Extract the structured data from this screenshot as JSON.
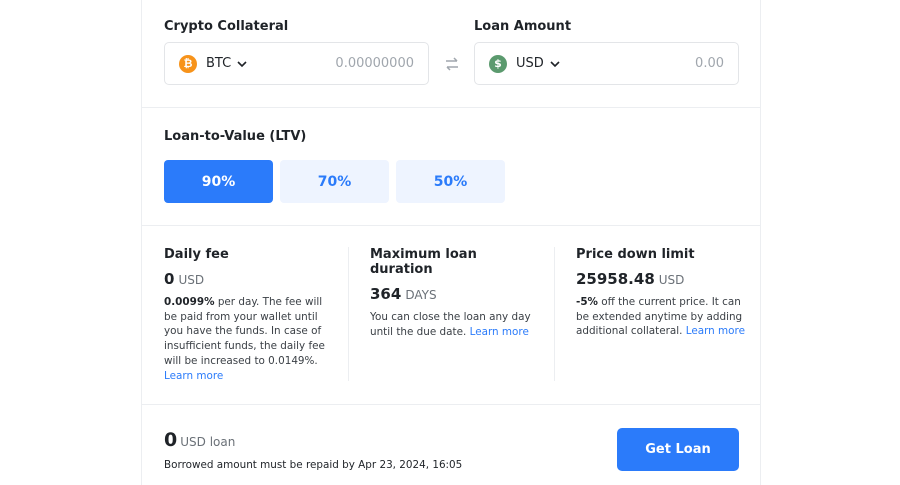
{
  "collateral": {
    "label": "Crypto Collateral",
    "currency": "BTC",
    "coin_glyph": "₿",
    "amount_placeholder": "0.00000000"
  },
  "loan": {
    "label": "Loan Amount",
    "currency": "USD",
    "coin_glyph": "$",
    "amount_placeholder": "0.00"
  },
  "ltv": {
    "title": "Loan-to-Value (LTV)",
    "options": [
      {
        "label": "90%",
        "selected": true
      },
      {
        "label": "70%",
        "selected": false
      },
      {
        "label": "50%",
        "selected": false
      }
    ]
  },
  "info": {
    "daily_fee": {
      "title": "Daily fee",
      "value": "0",
      "unit": "USD",
      "rate": "0.0099%",
      "desc": " per day. The fee will be paid from your wallet until you have the funds. In case of insufficient funds, the daily fee will be increased to 0.0149%.",
      "link": "Learn more"
    },
    "max_duration": {
      "title": "Maximum loan duration",
      "value": "364",
      "unit": "DAYS",
      "desc": "You can close the loan any day until the due date. ",
      "link": "Learn more"
    },
    "price_limit": {
      "title": "Price down limit",
      "value": "25958.48",
      "unit": "USD",
      "rate": "-5%",
      "desc": " off the current price. It can be extended anytime by adding additional collateral. ",
      "link": "Learn more"
    }
  },
  "footer": {
    "amount": "0",
    "unit": "USD loan",
    "repay_text": "Borrowed amount must be repaid by Apr 23, 2024, 16:05",
    "button_label": "Get Loan"
  },
  "colors": {
    "accent": "#2b7bfa",
    "accent_light": "#eef4ff",
    "btc": "#f7931a",
    "usd": "#5b9a6e"
  },
  "icons": {
    "swap": "swap-arrows-icon",
    "chevron": "chevron-down-icon"
  }
}
